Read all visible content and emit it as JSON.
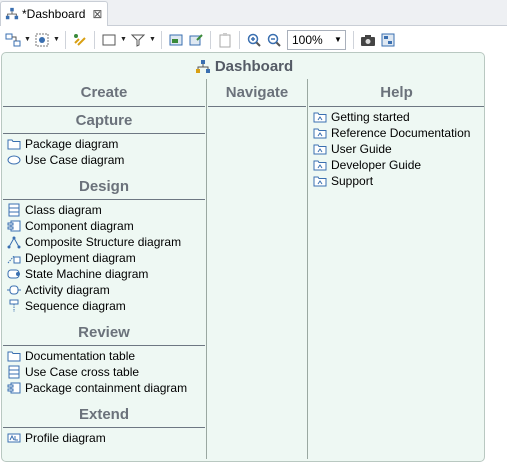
{
  "tab": {
    "title": "*Dashboard",
    "close_glyph": "⊠"
  },
  "toolbar": {
    "zoom_value": "100%"
  },
  "dashboard": {
    "title": "Dashboard",
    "columns": {
      "create": "Create",
      "navigate": "Navigate",
      "help": "Help"
    },
    "sections": {
      "capture": {
        "title": "Capture",
        "items": [
          {
            "label": "Package diagram",
            "icon": "folder-icon"
          },
          {
            "label": "Use Case diagram",
            "icon": "ellipse-icon"
          }
        ]
      },
      "design": {
        "title": "Design",
        "items": [
          {
            "label": "Class diagram",
            "icon": "class-icon"
          },
          {
            "label": "Component diagram",
            "icon": "component-icon"
          },
          {
            "label": "Composite Structure diagram",
            "icon": "composite-icon"
          },
          {
            "label": "Deployment diagram",
            "icon": "deployment-icon"
          },
          {
            "label": "State Machine diagram",
            "icon": "state-icon"
          },
          {
            "label": "Activity diagram",
            "icon": "activity-icon"
          },
          {
            "label": "Sequence diagram",
            "icon": "sequence-icon"
          }
        ]
      },
      "review": {
        "title": "Review",
        "items": [
          {
            "label": "Documentation table",
            "icon": "folder-icon"
          },
          {
            "label": "Use Case cross table",
            "icon": "table-icon"
          },
          {
            "label": "Package containment diagram",
            "icon": "component-icon"
          }
        ]
      },
      "extend": {
        "title": "Extend",
        "items": [
          {
            "label": "Profile diagram",
            "icon": "profile-icon"
          }
        ]
      }
    },
    "help": {
      "items": [
        {
          "label": "Getting started",
          "icon": "help-folder-icon"
        },
        {
          "label": "Reference Documentation",
          "icon": "help-folder-icon"
        },
        {
          "label": "User Guide",
          "icon": "help-folder-icon"
        },
        {
          "label": "Developer Guide",
          "icon": "help-folder-icon"
        },
        {
          "label": "Support",
          "icon": "help-folder-icon"
        }
      ]
    }
  }
}
